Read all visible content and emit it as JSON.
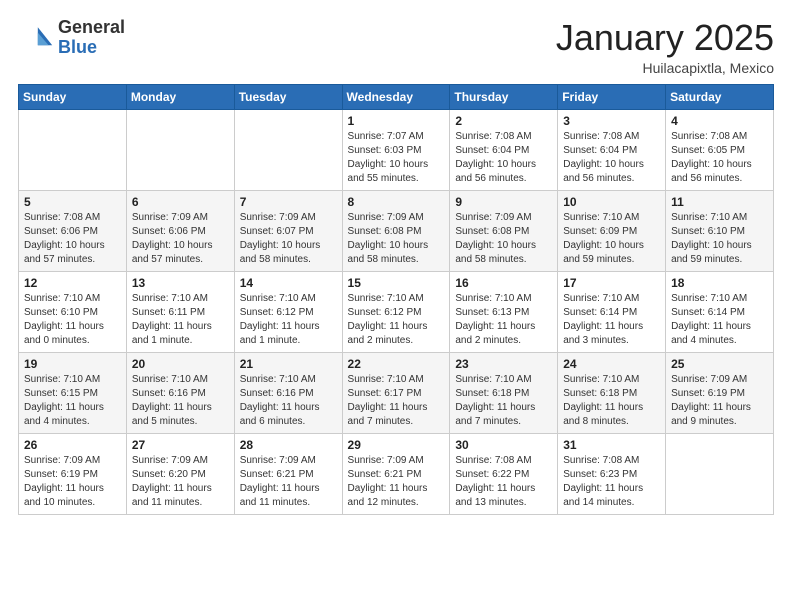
{
  "logo": {
    "general": "General",
    "blue": "Blue"
  },
  "title": "January 2025",
  "location": "Huilacapixtla, Mexico",
  "days_header": [
    "Sunday",
    "Monday",
    "Tuesday",
    "Wednesday",
    "Thursday",
    "Friday",
    "Saturday"
  ],
  "weeks": [
    [
      {
        "day": "",
        "info": ""
      },
      {
        "day": "",
        "info": ""
      },
      {
        "day": "",
        "info": ""
      },
      {
        "day": "1",
        "info": "Sunrise: 7:07 AM\nSunset: 6:03 PM\nDaylight: 10 hours\nand 55 minutes."
      },
      {
        "day": "2",
        "info": "Sunrise: 7:08 AM\nSunset: 6:04 PM\nDaylight: 10 hours\nand 56 minutes."
      },
      {
        "day": "3",
        "info": "Sunrise: 7:08 AM\nSunset: 6:04 PM\nDaylight: 10 hours\nand 56 minutes."
      },
      {
        "day": "4",
        "info": "Sunrise: 7:08 AM\nSunset: 6:05 PM\nDaylight: 10 hours\nand 56 minutes."
      }
    ],
    [
      {
        "day": "5",
        "info": "Sunrise: 7:08 AM\nSunset: 6:06 PM\nDaylight: 10 hours\nand 57 minutes."
      },
      {
        "day": "6",
        "info": "Sunrise: 7:09 AM\nSunset: 6:06 PM\nDaylight: 10 hours\nand 57 minutes."
      },
      {
        "day": "7",
        "info": "Sunrise: 7:09 AM\nSunset: 6:07 PM\nDaylight: 10 hours\nand 58 minutes."
      },
      {
        "day": "8",
        "info": "Sunrise: 7:09 AM\nSunset: 6:08 PM\nDaylight: 10 hours\nand 58 minutes."
      },
      {
        "day": "9",
        "info": "Sunrise: 7:09 AM\nSunset: 6:08 PM\nDaylight: 10 hours\nand 58 minutes."
      },
      {
        "day": "10",
        "info": "Sunrise: 7:10 AM\nSunset: 6:09 PM\nDaylight: 10 hours\nand 59 minutes."
      },
      {
        "day": "11",
        "info": "Sunrise: 7:10 AM\nSunset: 6:10 PM\nDaylight: 10 hours\nand 59 minutes."
      }
    ],
    [
      {
        "day": "12",
        "info": "Sunrise: 7:10 AM\nSunset: 6:10 PM\nDaylight: 11 hours\nand 0 minutes."
      },
      {
        "day": "13",
        "info": "Sunrise: 7:10 AM\nSunset: 6:11 PM\nDaylight: 11 hours\nand 1 minute."
      },
      {
        "day": "14",
        "info": "Sunrise: 7:10 AM\nSunset: 6:12 PM\nDaylight: 11 hours\nand 1 minute."
      },
      {
        "day": "15",
        "info": "Sunrise: 7:10 AM\nSunset: 6:12 PM\nDaylight: 11 hours\nand 2 minutes."
      },
      {
        "day": "16",
        "info": "Sunrise: 7:10 AM\nSunset: 6:13 PM\nDaylight: 11 hours\nand 2 minutes."
      },
      {
        "day": "17",
        "info": "Sunrise: 7:10 AM\nSunset: 6:14 PM\nDaylight: 11 hours\nand 3 minutes."
      },
      {
        "day": "18",
        "info": "Sunrise: 7:10 AM\nSunset: 6:14 PM\nDaylight: 11 hours\nand 4 minutes."
      }
    ],
    [
      {
        "day": "19",
        "info": "Sunrise: 7:10 AM\nSunset: 6:15 PM\nDaylight: 11 hours\nand 4 minutes."
      },
      {
        "day": "20",
        "info": "Sunrise: 7:10 AM\nSunset: 6:16 PM\nDaylight: 11 hours\nand 5 minutes."
      },
      {
        "day": "21",
        "info": "Sunrise: 7:10 AM\nSunset: 6:16 PM\nDaylight: 11 hours\nand 6 minutes."
      },
      {
        "day": "22",
        "info": "Sunrise: 7:10 AM\nSunset: 6:17 PM\nDaylight: 11 hours\nand 7 minutes."
      },
      {
        "day": "23",
        "info": "Sunrise: 7:10 AM\nSunset: 6:18 PM\nDaylight: 11 hours\nand 7 minutes."
      },
      {
        "day": "24",
        "info": "Sunrise: 7:10 AM\nSunset: 6:18 PM\nDaylight: 11 hours\nand 8 minutes."
      },
      {
        "day": "25",
        "info": "Sunrise: 7:09 AM\nSunset: 6:19 PM\nDaylight: 11 hours\nand 9 minutes."
      }
    ],
    [
      {
        "day": "26",
        "info": "Sunrise: 7:09 AM\nSunset: 6:19 PM\nDaylight: 11 hours\nand 10 minutes."
      },
      {
        "day": "27",
        "info": "Sunrise: 7:09 AM\nSunset: 6:20 PM\nDaylight: 11 hours\nand 11 minutes."
      },
      {
        "day": "28",
        "info": "Sunrise: 7:09 AM\nSunset: 6:21 PM\nDaylight: 11 hours\nand 11 minutes."
      },
      {
        "day": "29",
        "info": "Sunrise: 7:09 AM\nSunset: 6:21 PM\nDaylight: 11 hours\nand 12 minutes."
      },
      {
        "day": "30",
        "info": "Sunrise: 7:08 AM\nSunset: 6:22 PM\nDaylight: 11 hours\nand 13 minutes."
      },
      {
        "day": "31",
        "info": "Sunrise: 7:08 AM\nSunset: 6:23 PM\nDaylight: 11 hours\nand 14 minutes."
      },
      {
        "day": "",
        "info": ""
      }
    ]
  ]
}
